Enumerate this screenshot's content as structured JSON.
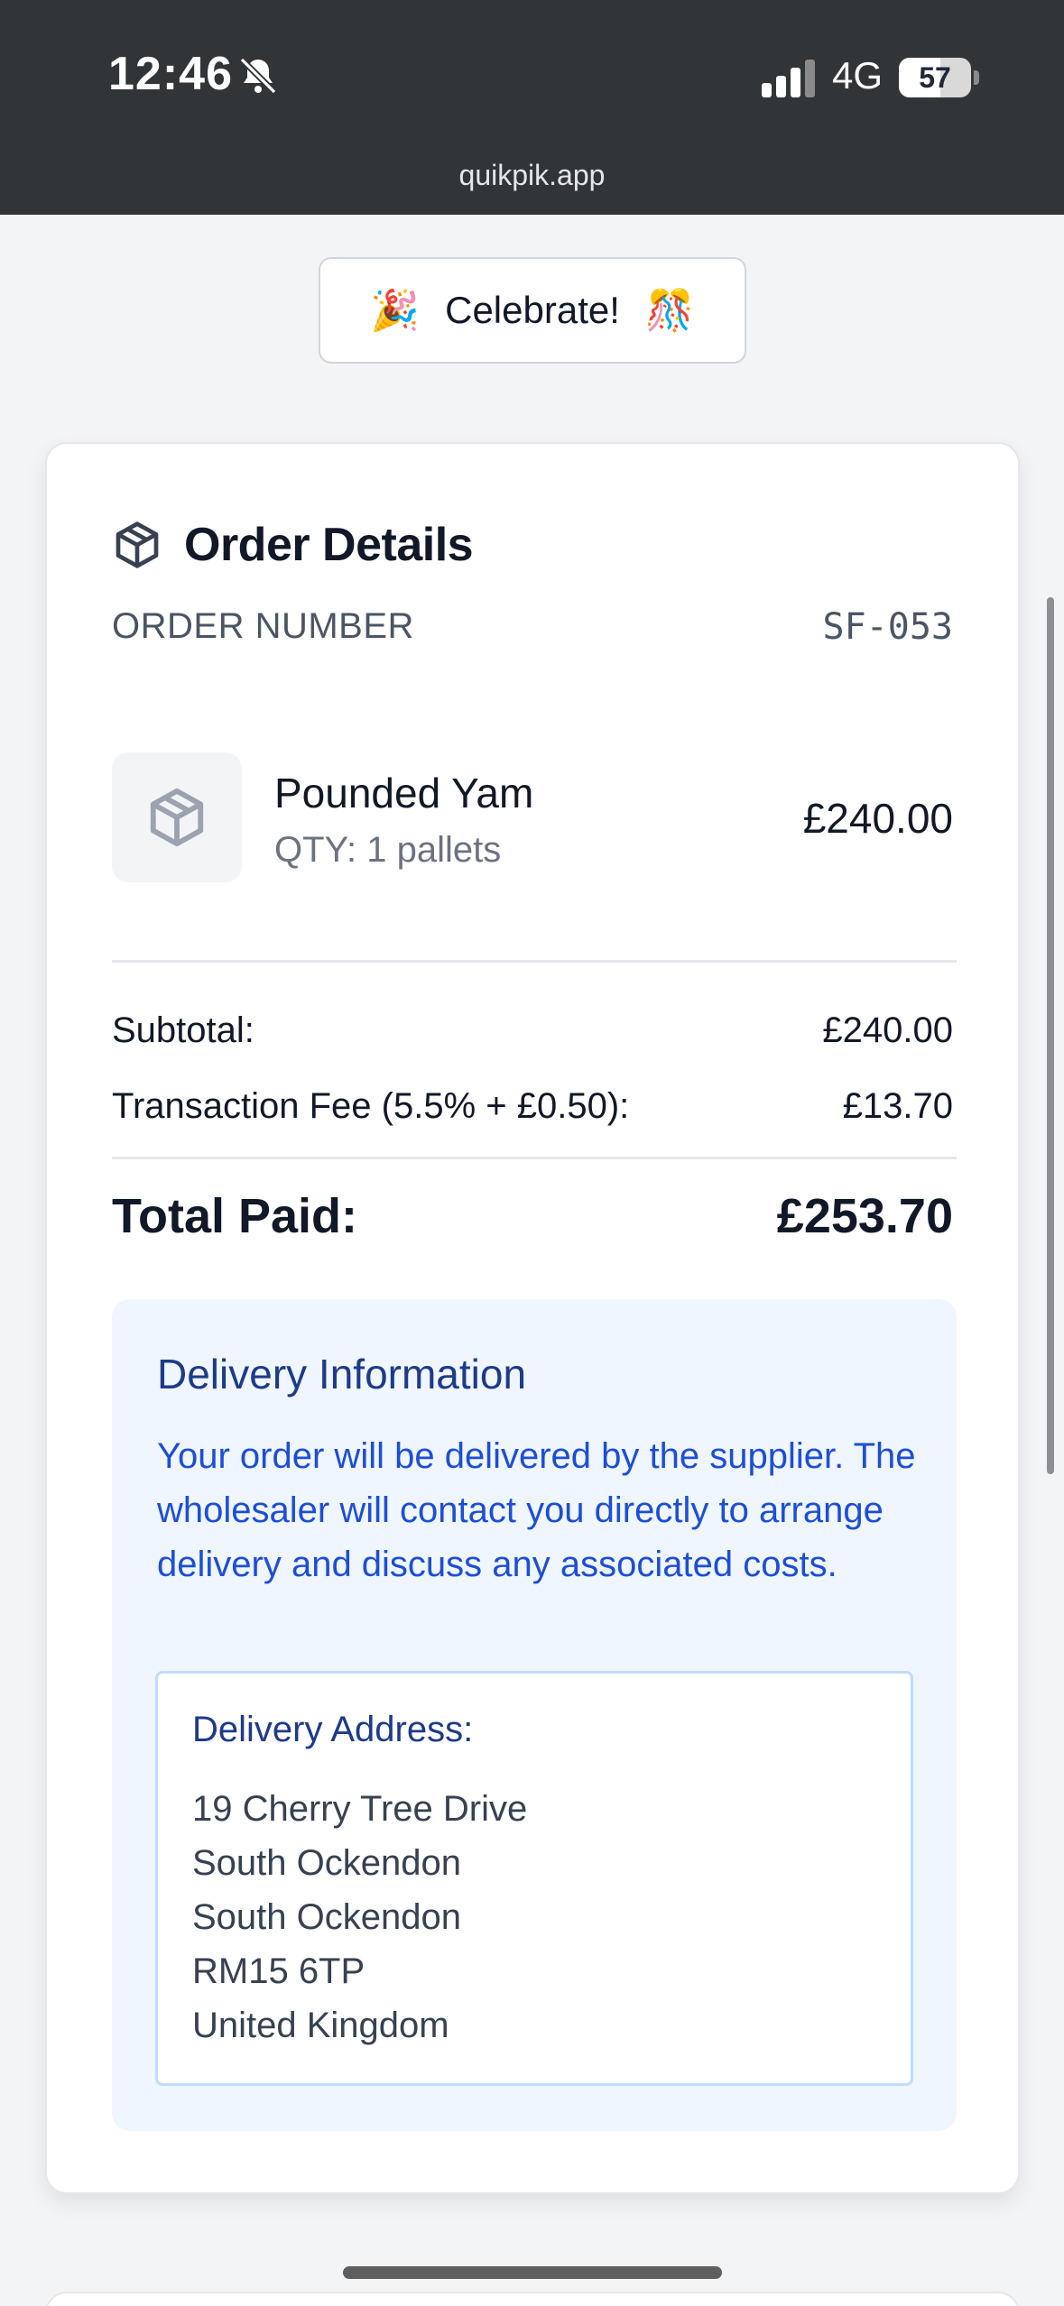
{
  "status_bar": {
    "time": "12:46",
    "network": "4G",
    "battery": "57",
    "battery_level_percent": 57,
    "icons": [
      "bell-slash-icon",
      "signal-icon"
    ]
  },
  "browser": {
    "url": "quikpik.app"
  },
  "celebrate": {
    "label": "Celebrate!",
    "emoji_left": "🎉",
    "emoji_right": "🎊"
  },
  "order": {
    "title": "Order Details",
    "number_label": "ORDER NUMBER",
    "number_value": "SF-053",
    "item": {
      "name": "Pounded Yam",
      "qty": "QTY: 1 pallets",
      "price": "£240.00"
    },
    "subtotal_label": "Subtotal:",
    "subtotal_value": "£240.00",
    "fee_label": "Transaction Fee (5.5% + £0.50):",
    "fee_value": "£13.70",
    "total_label": "Total Paid:",
    "total_value": "£253.70"
  },
  "delivery": {
    "title": "Delivery Information",
    "text": "Your order will be delivered by the supplier. The wholesaler will contact you directly to arrange delivery and discuss any associated costs.",
    "address_title": "Delivery Address:",
    "address": {
      "line1": "19 Cherry Tree Drive",
      "line2": "South Ockendon",
      "line3": "South Ockendon",
      "line4": "RM15 6TP",
      "line5": "United Kingdom"
    }
  },
  "colors": {
    "status_bar_bg": "#323538",
    "delivery_bg": "#eff6ff",
    "delivery_title": "#1e3a8a",
    "delivery_text": "#1d4ed8"
  }
}
